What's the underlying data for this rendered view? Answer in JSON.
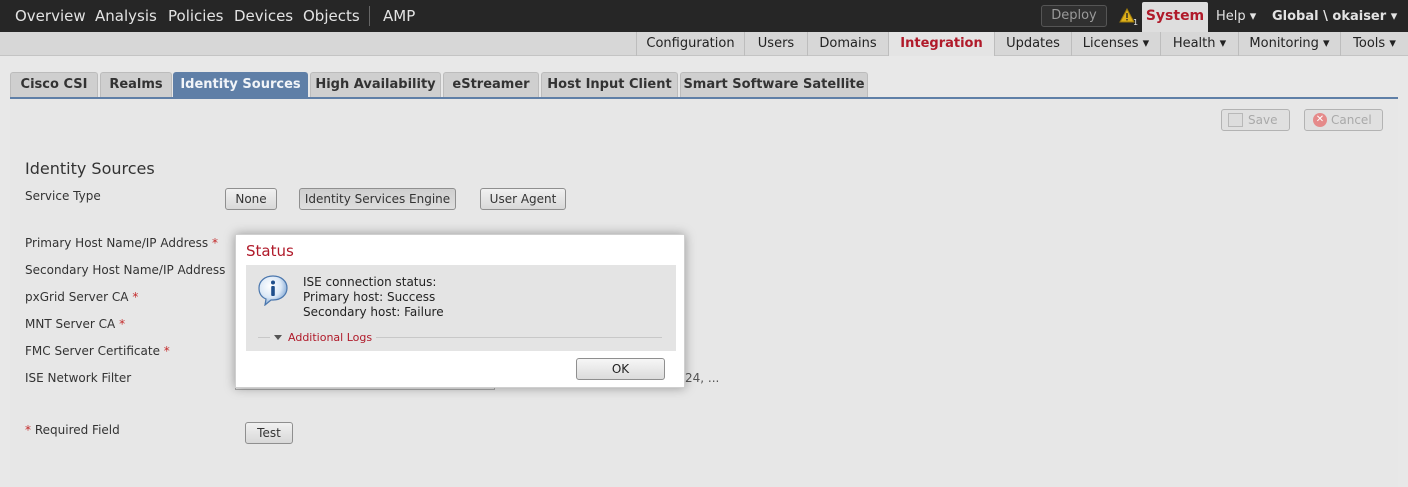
{
  "topnav": {
    "items": [
      "Overview",
      "Analysis",
      "Policies",
      "Devices",
      "Objects",
      "AMP"
    ],
    "deploy_label": "Deploy",
    "alert_count": "1",
    "system_label": "System",
    "help_label": "Help ▾",
    "user_label": "Global \\ okaiser ▾"
  },
  "subnav": {
    "items": [
      "Configuration",
      "Users",
      "Domains",
      "Integration",
      "Updates",
      "Licenses ▾",
      "Health ▾",
      "Monitoring ▾",
      "Tools ▾"
    ],
    "active": "Integration"
  },
  "tabs": {
    "items": [
      "Cisco CSI",
      "Realms",
      "Identity Sources",
      "High Availability",
      "eStreamer",
      "Host Input Client",
      "Smart Software Satellite"
    ],
    "active": "Identity Sources"
  },
  "actions": {
    "save_label": "Save",
    "cancel_label": "Cancel"
  },
  "form": {
    "section_title": "Identity Sources",
    "service_type_label": "Service Type",
    "service_buttons": [
      "None",
      "Identity Services Engine",
      "User Agent"
    ],
    "primary_host_label": "Primary Host Name/IP Address",
    "secondary_host_label": "Secondary Host Name/IP Address",
    "pxgrid_ca_label": "pxGrid Server CA",
    "mnt_ca_label": "MNT Server CA",
    "fmc_cert_label": "FMC Server Certificate",
    "ise_filter_label": "ISE Network Filter",
    "filter_hint": "24, ...",
    "required_asterisk": "*",
    "required_note": "Required Field",
    "test_label": "Test"
  },
  "dialog": {
    "title": "Status",
    "lines": [
      "ISE connection status:",
      "Primary host: Success",
      "Secondary host: Failure"
    ],
    "logs_label": "Additional Logs",
    "ok_label": "OK"
  },
  "colors": {
    "accent": "#b01a2a",
    "tab_active": "#5f7fa7",
    "topbar": "#262626"
  }
}
